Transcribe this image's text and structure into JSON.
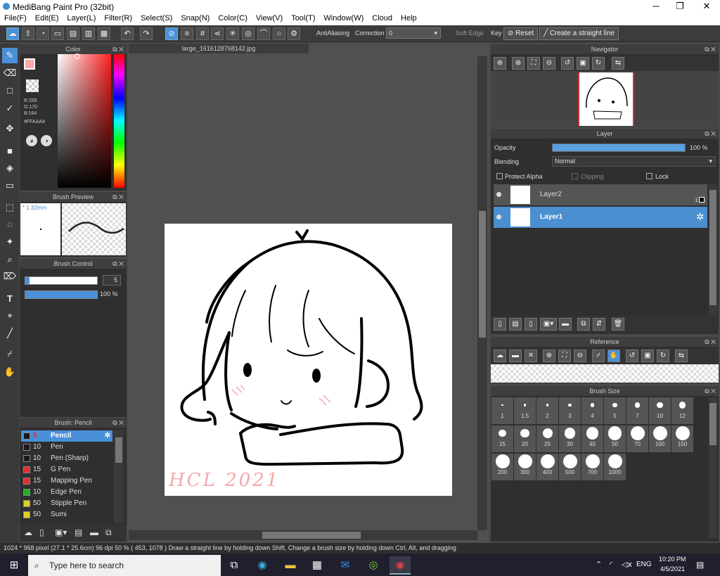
{
  "app": {
    "title": "MediBang Paint Pro (32bit)"
  },
  "menu": [
    "File(F)",
    "Edit(E)",
    "Layer(L)",
    "Filter(R)",
    "Select(S)",
    "Snap(N)",
    "Color(C)",
    "View(V)",
    "Tool(T)",
    "Window(W)",
    "Cloud",
    "Help"
  ],
  "toolbar": {
    "antialiasing": "AntiAliasing",
    "correction_label": "Correction",
    "correction_value": "0",
    "soft_edge": "Soft Edge",
    "key": "Key",
    "reset": "Reset",
    "straight_line": "Create a straight line"
  },
  "document": {
    "tab": "large_1616128768142.jpg",
    "signature": "HCL 2021"
  },
  "color_panel": {
    "title": "Color",
    "r": "R:255",
    "g": "G:170",
    "b": "B:164",
    "hex": "#FFAAA4",
    "primary": "#ffaaa4"
  },
  "brush_preview": {
    "title": "Brush Preview",
    "size": "* 1.32mm"
  },
  "brush_control": {
    "title": "Brush Control",
    "size": "5",
    "opacity": "100 %",
    "opacity_value": 100
  },
  "brush_list": {
    "title": "Brush: Pencil",
    "items": [
      {
        "n": "5",
        "name": "Pencil",
        "color": "#1a1a1a"
      },
      {
        "n": "10",
        "name": "Pen",
        "color": "#1a1a1a"
      },
      {
        "n": "10",
        "name": "Pen (Sharp)",
        "color": "#1a1a1a"
      },
      {
        "n": "15",
        "name": "G Pen",
        "color": "#e03030"
      },
      {
        "n": "15",
        "name": "Mapping Pen",
        "color": "#e03030"
      },
      {
        "n": "10",
        "name": "Edge Pen",
        "color": "#20b020"
      },
      {
        "n": "50",
        "name": "Stipple Pen",
        "color": "#e0d020"
      },
      {
        "n": "50",
        "name": "Sumi",
        "color": "#e0d020"
      }
    ]
  },
  "navigator": {
    "title": "Navigator"
  },
  "layer_panel": {
    "title": "Layer",
    "opacity_label": "Opacity",
    "opacity": "100 %",
    "opacity_value": 100,
    "blending_label": "Blending",
    "blending": "Normal",
    "protect_alpha": "Protect Alpha",
    "clipping": "Clipping",
    "lock": "Lock",
    "layers": [
      {
        "name": "Layer2",
        "badge": "1"
      },
      {
        "name": "Layer1"
      }
    ]
  },
  "reference": {
    "title": "Reference"
  },
  "brush_size": {
    "title": "Brush Size",
    "sizes": [
      "1",
      "1.5",
      "2",
      "3",
      "4",
      "5",
      "7",
      "10",
      "12",
      "15",
      "20",
      "25",
      "30",
      "40",
      "50",
      "70",
      "100",
      "150",
      "200",
      "300",
      "400",
      "500",
      "700",
      "1000"
    ]
  },
  "status": "1024 * 968 pixel   (27.1 * 25.6cm)   96 dpi   50 %   ( 453, 1078 )   Draw a straight line by holding down Shift, Change a brush size by holding down Ctrl, Alt, and dragging",
  "taskbar": {
    "search": "Type here to search",
    "lang": "ENG",
    "time": "10:20 PM",
    "date": "4/5/2021"
  }
}
